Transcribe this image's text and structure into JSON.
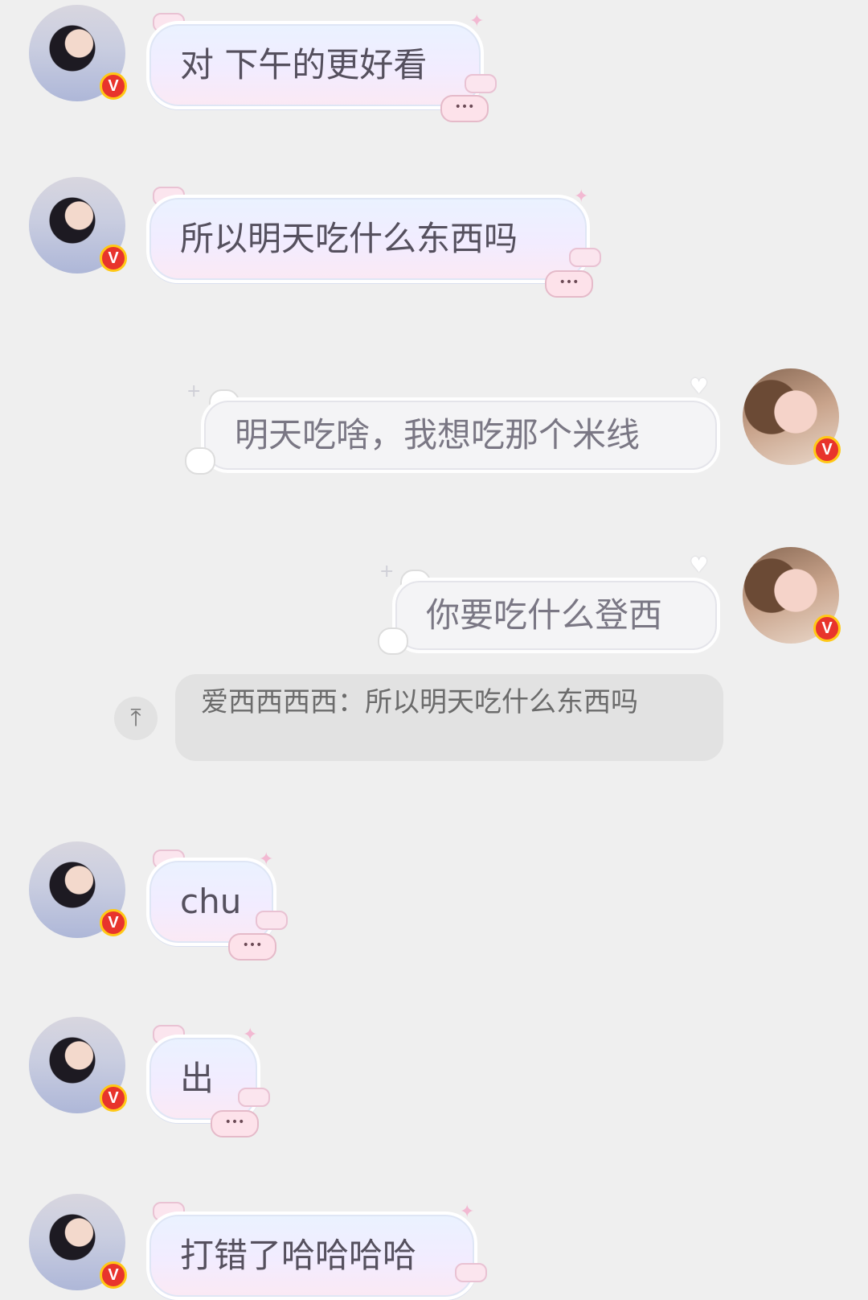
{
  "messages": [
    {
      "side": "left",
      "text": "对 下午的更好看"
    },
    {
      "side": "left",
      "text": "所以明天吃什么东西吗"
    },
    {
      "side": "right",
      "text": "明天吃啥，我想吃那个米线"
    },
    {
      "side": "right",
      "text": "你要吃什么登西"
    },
    {
      "side": "left",
      "text": "chu"
    },
    {
      "side": "left",
      "text": "出"
    },
    {
      "side": "left",
      "text": "打错了哈哈哈哈"
    }
  ],
  "quote": {
    "text": "爱西西西西：所以明天吃什么东西吗"
  },
  "badge": {
    "letter": "V",
    "color": "#e8342c",
    "ring": "#ffc816"
  },
  "icons": {
    "quote": "arrow-up-to-top-icon"
  }
}
